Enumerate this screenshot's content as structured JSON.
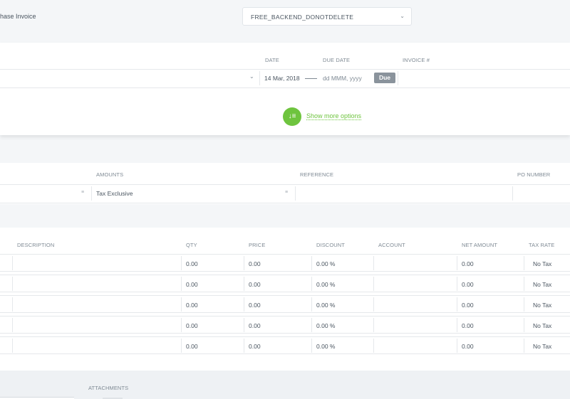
{
  "header": {
    "page_type": "hase Invoice",
    "org_select_value": "FREE_BACKEND_DONOTDELETE"
  },
  "details": {
    "date_label": "DATE",
    "due_date_label": "DUE DATE",
    "invoice_label": "INVOICE #",
    "date_value": "14 Mar, 2018",
    "due_date_placeholder": "dd MMM, yyyy",
    "due_badge": "Due",
    "show_more": "Show more options"
  },
  "amounts": {
    "amounts_label": "AMOUNTS",
    "reference_label": "REFERENCE",
    "po_number_label": "PO NUMBER",
    "amounts_value": "Tax Exclusive"
  },
  "items": {
    "columns": [
      "DESCRIPTION",
      "QTY",
      "PRICE",
      "DISCOUNT",
      "ACCOUNT",
      "NET AMOUNT",
      "TAX RATE"
    ],
    "rows": [
      {
        "qty": "0.00",
        "price": "0.00",
        "discount": "0.00 %",
        "net": "0.00",
        "tax": "No Tax"
      },
      {
        "qty": "0.00",
        "price": "0.00",
        "discount": "0.00 %",
        "net": "0.00",
        "tax": "No Tax"
      },
      {
        "qty": "0.00",
        "price": "0.00",
        "discount": "0.00 %",
        "net": "0.00",
        "tax": "No Tax"
      },
      {
        "qty": "0.00",
        "price": "0.00",
        "discount": "0.00 %",
        "net": "0.00",
        "tax": "No Tax"
      },
      {
        "qty": "0.00",
        "price": "0.00",
        "discount": "0.00 %",
        "net": "0.00",
        "tax": "No Tax"
      }
    ]
  },
  "footer": {
    "attachments_label": "ATTACHMENTS"
  }
}
